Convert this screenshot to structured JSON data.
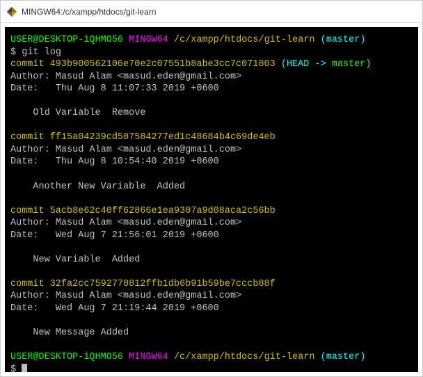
{
  "window": {
    "title": "MINGW64:/c/xampp/htdocs/git-learn"
  },
  "prompt": {
    "user": "USER@DESKTOP-1QHMO56",
    "shell": "MINGW64",
    "path": "/c/xampp/htdocs/git-learn",
    "branch": "(master)",
    "symbol": "$"
  },
  "command": "git log",
  "commits": [
    {
      "hash": "commit 493b900562106e70e2c07551b8abe3cc7c071803",
      "refs_open": " (",
      "refs_head": "HEAD -> ",
      "refs_master": "master",
      "refs_close": ")",
      "author": "Author: Masud Alam <masud.eden@gmail.com>",
      "date": "Date:   Thu Aug 8 11:07:33 2019 +0600",
      "message": "    Old Variable  Remove"
    },
    {
      "hash": "commit ff15a04239cd507584277ed1c48684b4c69de4eb",
      "author": "Author: Masud Alam <masud.eden@gmail.com>",
      "date": "Date:   Thu Aug 8 10:54:40 2019 +0600",
      "message": "    Another New Variable  Added"
    },
    {
      "hash": "commit 5acb8e62c40ff62866e1ea9307a9d08aca2c56bb",
      "author": "Author: Masud Alam <masud.eden@gmail.com>",
      "date": "Date:   Wed Aug 7 21:56:01 2019 +0600",
      "message": "    New Variable  Added"
    },
    {
      "hash": "commit 32fa2cc7592770812ffb1db6b91b59be7cccb88f",
      "author": "Author: Masud Alam <masud.eden@gmail.com>",
      "date": "Date:   Wed Aug 7 21:19:44 2019 +0600",
      "message": "    New Message Added"
    }
  ]
}
